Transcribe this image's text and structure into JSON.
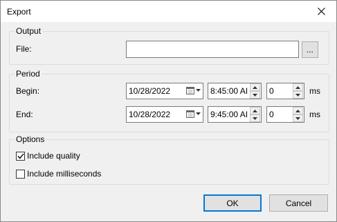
{
  "window": {
    "title": "Export"
  },
  "output": {
    "group_title": "Output",
    "file_label": "File:",
    "file_value": "",
    "browse_label": "..."
  },
  "period": {
    "group_title": "Period",
    "begin": {
      "label": "Begin:",
      "date": "10/28/2022",
      "time": "8:45:00 AI",
      "ms": "0",
      "unit": "ms"
    },
    "end": {
      "label": "End:",
      "date": "10/28/2022",
      "time": "9:45:00 AI",
      "ms": "0",
      "unit": "ms"
    }
  },
  "options": {
    "group_title": "Options",
    "include_quality": {
      "label": "Include quality",
      "checked": true
    },
    "include_ms": {
      "label": "Include milliseconds",
      "checked": false
    }
  },
  "buttons": {
    "ok": "OK",
    "cancel": "Cancel"
  },
  "icons": {
    "close": "close-icon",
    "calendar": "calendar-icon",
    "spin_up": "spin-up-icon",
    "spin_down": "spin-down-icon",
    "check": "check-icon"
  },
  "colors": {
    "default_button_border": "#0078d7"
  }
}
